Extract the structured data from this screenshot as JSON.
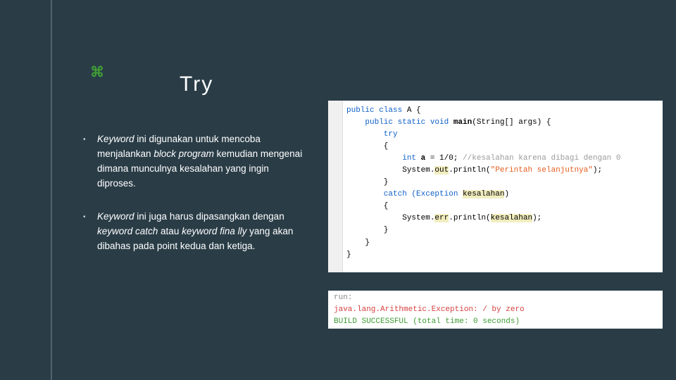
{
  "icon_glyph": "⌘",
  "title": "Try",
  "bullets": [
    {
      "pre": "Keyword",
      "rest": " ini digunakan untuk mencoba menjalankan ",
      "em2": "block program",
      "rest2": " kemudian mengenai dimana munculnya kesalahan yang ingin diproses."
    },
    {
      "pre": "Keyword",
      "rest": " ini juga harus dipasangkan dengan ",
      "em2": "keyword catch",
      "rest2": " atau ",
      "em3": "keyword fina lly",
      "rest3": " yang akan dibahas pada point kedua dan ketiga."
    }
  ],
  "code": {
    "l1a": "public class ",
    "l1b": "A {",
    "l2a": "    public static void ",
    "l2b": "main",
    "l2c": "(String[] args) {",
    "l3": "        try",
    "l4": "        {",
    "l5a": "            int ",
    "l5b": "a",
    "l5c": " = 1/0; ",
    "l5d": "//kesalahan karena dibagi dengan 0",
    "l6a": "            System.",
    "l6b": "out",
    "l6c": ".println(",
    "l6d": "\"Perintah selanjutnya\"",
    "l6e": ");",
    "l7": "        }",
    "l8a": "        catch (Exception ",
    "l8b": "kesalahan",
    "l8c": ")",
    "l9": "        {",
    "l10a": "            System.",
    "l10b": "err",
    "l10c": ".println(",
    "l10d": "kesalahan",
    "l10e": ");",
    "l11": "        }",
    "l12": "    }",
    "l13": "}"
  },
  "output": {
    "run": "run:",
    "err": "java.lang.Arithmetic.Exception: / by zero",
    "ok": "BUILD SUCCESSFUL (total time: 0 seconds)"
  }
}
